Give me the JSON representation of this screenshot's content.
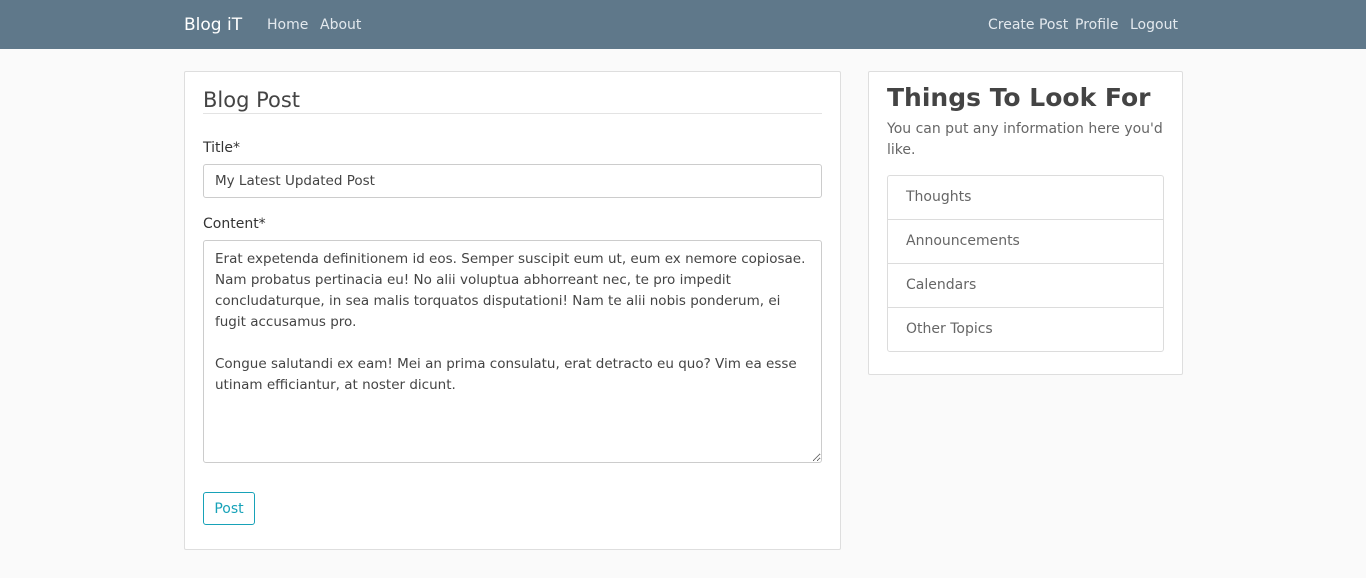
{
  "navbar": {
    "brand": "Blog iT",
    "left_links": [
      "Home",
      "About"
    ],
    "right_links": [
      "Create Post",
      "Profile",
      "Logout"
    ],
    "background": "#5f788a"
  },
  "form": {
    "legend": "Blog Post",
    "title_label": "Title*",
    "title_value": "My Latest Updated Post",
    "content_label": "Content*",
    "content_value": "Erat expetenda definitionem id eos. Semper suscipit eum ut, eum ex nemore copiosae. Nam probatus pertinacia eu! No alii voluptua abhorreant nec, te pro impedit concludaturque, in sea malis torquatos disputationi! Nam te alii nobis ponderum, ei fugit accusamus pro.\n\nCongue salutandi ex eam! Mei an prima consulatu, erat detracto eu quo? Vim ea esse utinam efficiantur, at noster dicunt.",
    "submit_label": "Post",
    "submit_color": "#17a2b8"
  },
  "sidebar": {
    "heading": "Things To Look For",
    "text": "You can put any information here you'd like.",
    "items": [
      "Thoughts",
      "Announcements",
      "Calendars",
      "Other Topics"
    ]
  }
}
